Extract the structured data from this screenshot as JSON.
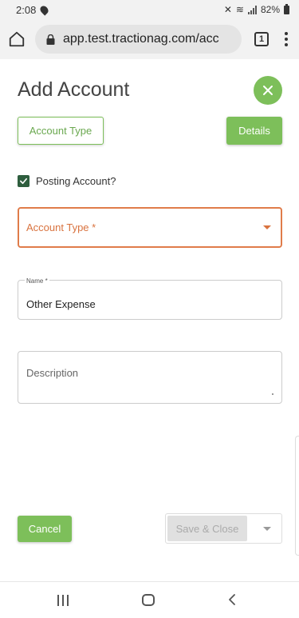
{
  "status_bar": {
    "time": "2:08",
    "battery": "82%"
  },
  "browser": {
    "url": "app.test.tractionag.com/acc",
    "tab_count": "1"
  },
  "page": {
    "title": "Add Account"
  },
  "tabs": {
    "account_type_label": "Account Type",
    "details_label": "Details"
  },
  "form": {
    "posting_account_label": "Posting Account?",
    "posting_account_checked": true,
    "account_type_select_label": "Account Type *",
    "name_label": "Name *",
    "name_value": "Other Expense",
    "description_placeholder": "Description"
  },
  "actions": {
    "cancel_label": "Cancel",
    "save_close_label": "Save & Close"
  },
  "colors": {
    "accent_green": "#7dbf5a",
    "error_orange": "#e07c4a",
    "checkbox_dark": "#2e5e3e"
  }
}
